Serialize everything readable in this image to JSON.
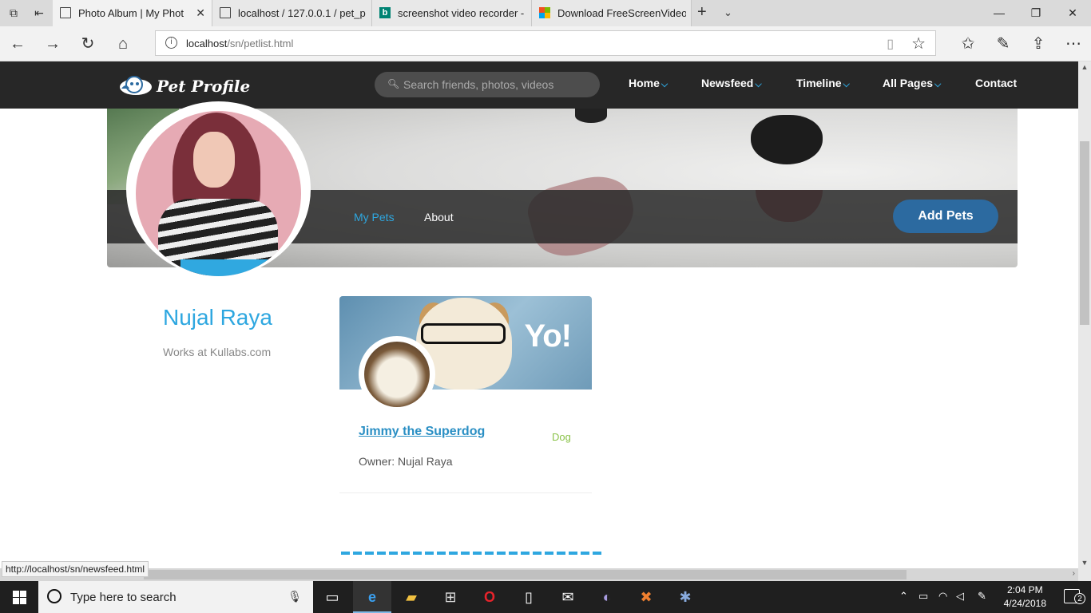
{
  "browser": {
    "tabs": [
      {
        "title": "Photo Album | My Phot",
        "icon": "page-icon"
      },
      {
        "title": "localhost / 127.0.0.1 / pet_p",
        "icon": "page-icon"
      },
      {
        "title": "screenshot video recorder -",
        "icon": "bing-icon"
      },
      {
        "title": "Download FreeScreenVideo",
        "icon": "microsoft-icon"
      }
    ],
    "address": {
      "host": "localhost",
      "path": "/sn/petlist.html"
    },
    "status_url": "http://localhost/sn/newsfeed.html"
  },
  "site": {
    "brand": "Pet Profile",
    "search_placeholder": "Search friends, photos, videos",
    "menu": [
      {
        "label": "Home",
        "has_dropdown": true
      },
      {
        "label": "Newsfeed",
        "has_dropdown": true
      },
      {
        "label": "Timeline",
        "has_dropdown": true
      },
      {
        "label": "All Pages",
        "has_dropdown": true
      },
      {
        "label": "Contact",
        "has_dropdown": false
      }
    ],
    "accent": "#2ea7e0"
  },
  "profile": {
    "tabs": [
      {
        "label": "My Pets",
        "active": true
      },
      {
        "label": "About",
        "active": false
      }
    ],
    "add_button": "Add Pets",
    "name": "Nujal Raya",
    "work": "Works at Kullabs.com"
  },
  "pets": [
    {
      "cover_text": "Yo!",
      "name": "Jimmy the Superdog",
      "type": "Dog",
      "owner": "Owner: Nujal Raya"
    }
  ],
  "taskbar": {
    "search_placeholder": "Type here to search",
    "time": "2:04 PM",
    "date": "4/24/2018",
    "notifications": "2"
  }
}
